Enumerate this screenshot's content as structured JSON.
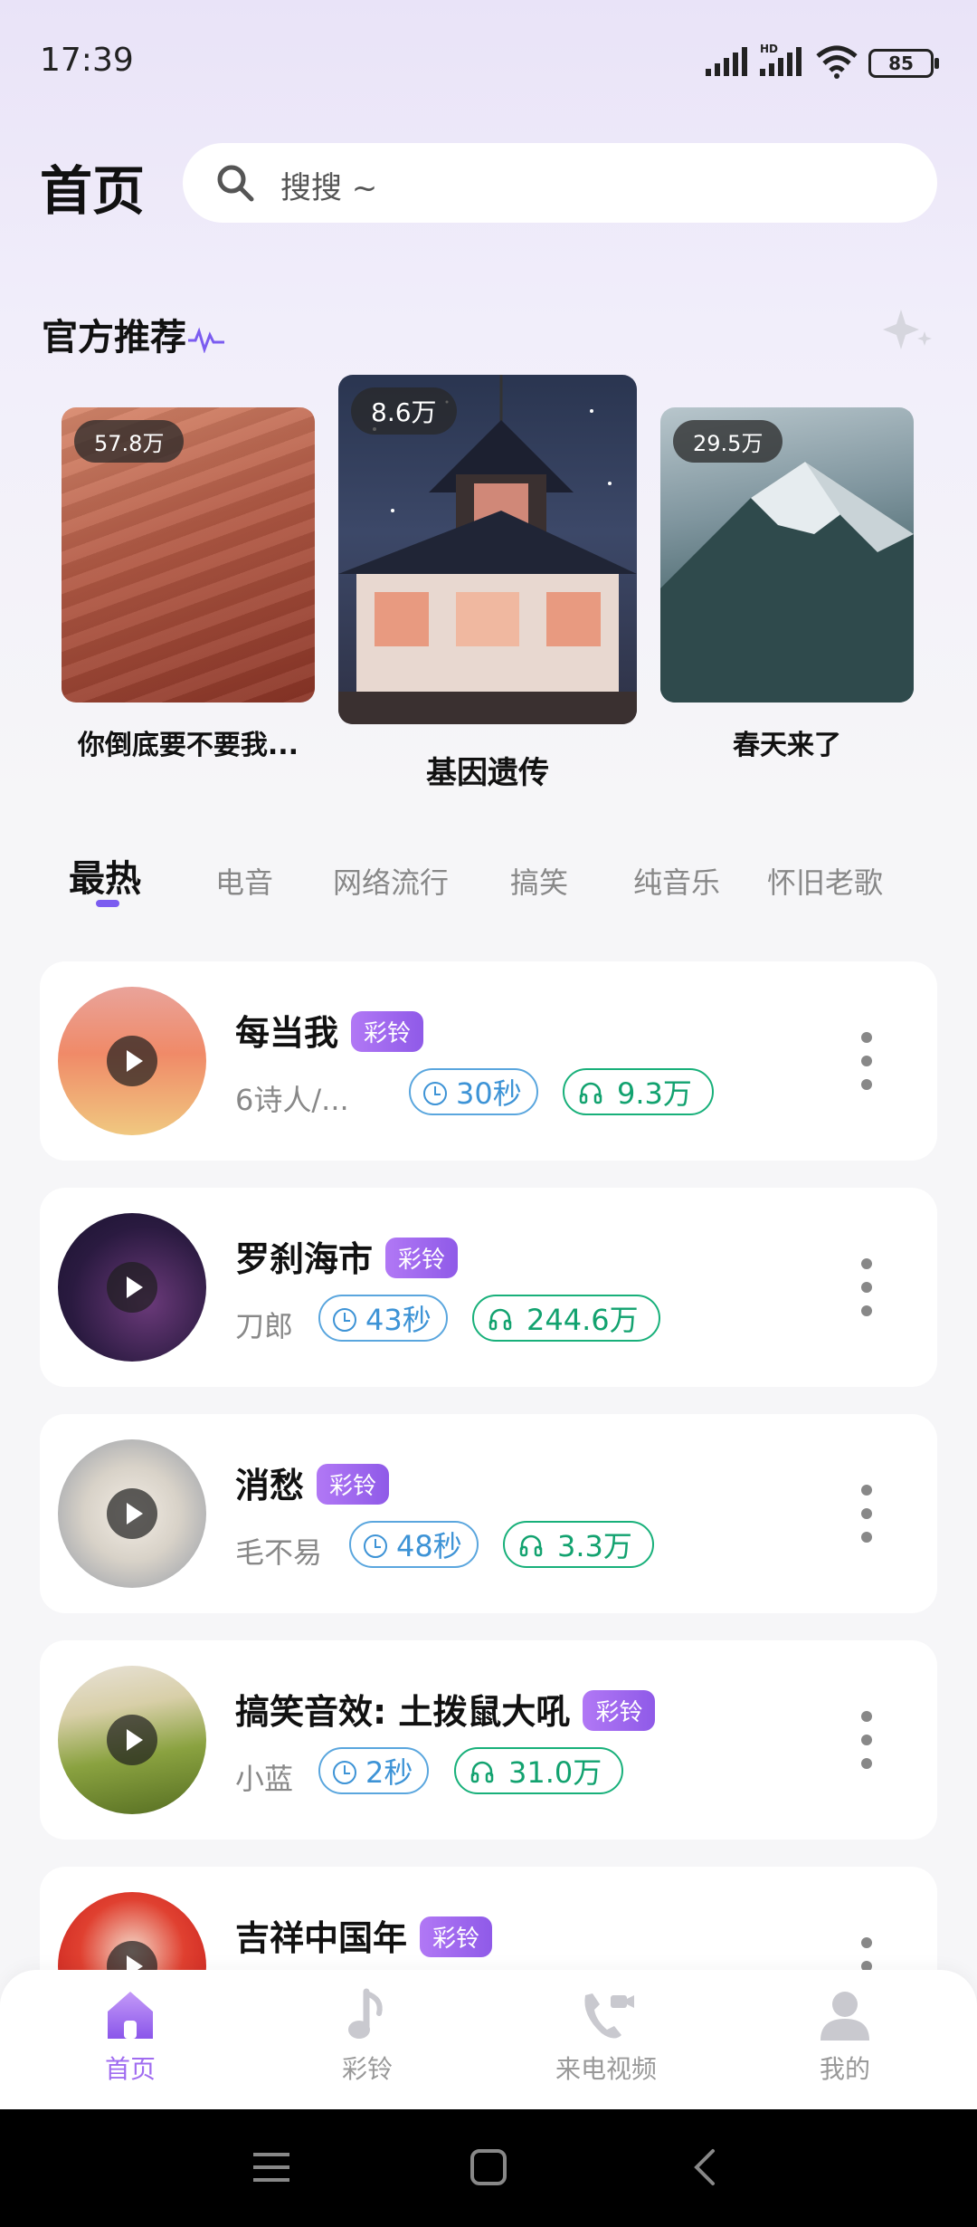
{
  "status_bar": {
    "time": "17:39",
    "battery": "85"
  },
  "header": {
    "title": "首页",
    "search_placeholder": "搜搜 ~"
  },
  "recommend": {
    "title": "官方推荐",
    "cards": [
      {
        "title": "你倒底要不要我...",
        "plays": "57.8万"
      },
      {
        "title": "基因遗传",
        "plays": "8.6万"
      },
      {
        "title": "春天来了",
        "plays": "29.5万"
      }
    ]
  },
  "tabs": [
    "最热",
    "电音",
    "网络流行",
    "搞笑",
    "纯音乐",
    "怀旧老歌"
  ],
  "songs": [
    {
      "title": "每当我",
      "tag": "彩铃",
      "singer": "6诗人/...",
      "duration": "30秒",
      "plays": "9.3万"
    },
    {
      "title": "罗刹海市",
      "tag": "彩铃",
      "singer": "刀郎",
      "duration": "43秒",
      "plays": "244.6万"
    },
    {
      "title": "消愁",
      "tag": "彩铃",
      "singer": "毛不易",
      "duration": "48秒",
      "plays": "3.3万"
    },
    {
      "title": "搞笑音效: 土拨鼠大吼",
      "tag": "彩铃",
      "singer": "小蓝",
      "duration": "2秒",
      "plays": "31.0万"
    },
    {
      "title": "吉祥中国年",
      "tag": "彩铃"
    }
  ],
  "nav": [
    {
      "label": "首页",
      "icon": "home-icon"
    },
    {
      "label": "彩铃",
      "icon": "music-note-icon"
    },
    {
      "label": "来电视频",
      "icon": "video-call-icon"
    },
    {
      "label": "我的",
      "icon": "user-icon"
    }
  ],
  "colors": {
    "accent": "#8f5ae8",
    "duration": "#3d93d6",
    "plays": "#12a26f"
  }
}
